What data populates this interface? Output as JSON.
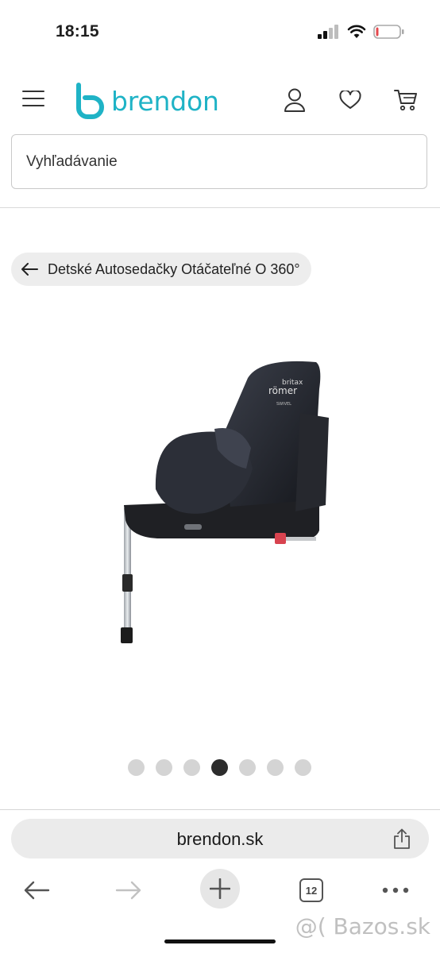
{
  "status_bar": {
    "time": "18:15",
    "battery_level": 0.1,
    "battery_color": "#e5484d"
  },
  "header": {
    "logo_text": "brendon",
    "brand_color": "#1fb3c6"
  },
  "search": {
    "placeholder": "Vyhľadávanie"
  },
  "breadcrumb": {
    "label": "Detské Autosedačky Otáčateľné O 360°"
  },
  "product_image": {
    "brand_text_1": "britax",
    "brand_text_2": "römer",
    "model_text": "SWIVEL"
  },
  "carousel": {
    "count": 7,
    "active_index": 3
  },
  "browser": {
    "url": "brendon.sk",
    "tab_count": "12"
  },
  "watermark": "@( Bazos.sk"
}
